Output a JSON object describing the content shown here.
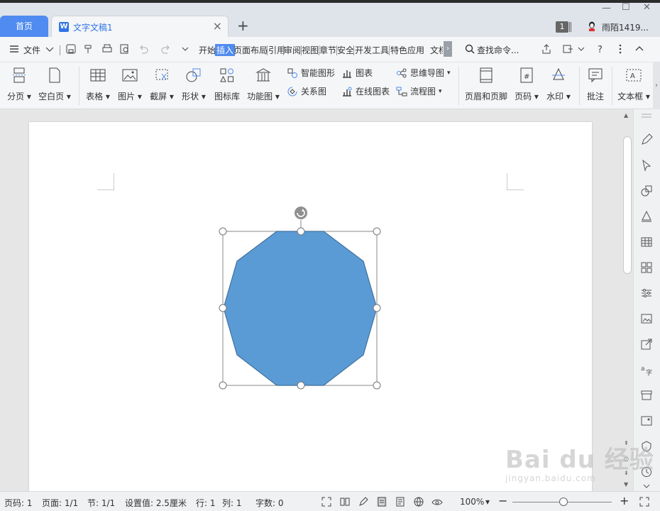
{
  "tabs": {
    "home_label": "首页",
    "doc_label": "文字文稿1",
    "badge_count": "1",
    "user_name": "雨陌1419..."
  },
  "menu": {
    "file_label": "文件",
    "items": [
      "开始",
      "插入",
      "页面布局",
      "引用",
      "审阅",
      "视图",
      "章节",
      "安全",
      "开发工具",
      "特色应用",
      "文档"
    ],
    "active_index": 1,
    "search_placeholder": "查找命令..."
  },
  "ribbon": {
    "page_break": "分页",
    "blank_page": "空白页",
    "table": "表格",
    "picture": "图片",
    "screenshot": "截屏",
    "shape": "形状",
    "icon_lib": "图标库",
    "func_chart": "功能图",
    "smart_shape": "智能图形",
    "chart": "图表",
    "relation": "关系图",
    "online_chart": "在线图表",
    "mindmap": "思维导图",
    "flowchart": "流程图",
    "header_footer": "页眉和页脚",
    "page_number": "页码",
    "watermark": "水印",
    "comment": "批注",
    "textbox": "文本框"
  },
  "shape": {
    "type": "decagon",
    "fill": "#5b9bd5",
    "stroke": "#41719c"
  },
  "status": {
    "page_num": "页码: 1",
    "pages": "页面: 1/1",
    "section": "节: 1/1",
    "setting": "设置值: 2.5厘米",
    "row": "行: 1",
    "col": "列: 1",
    "words": "字数: 0",
    "zoom": "100%"
  },
  "colors": {
    "accent": "#4f8bf0",
    "doc_tab_text": "#2f74e8"
  },
  "watermark": {
    "big": "Bai du 经验",
    "small": "jingyan.baidu.com"
  }
}
